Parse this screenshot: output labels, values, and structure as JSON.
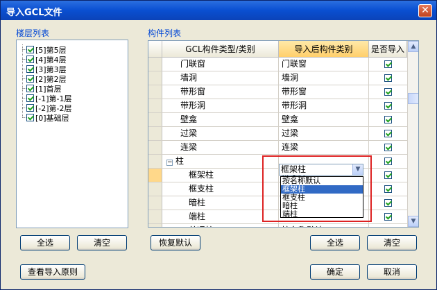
{
  "window": {
    "title": "导入GCL文件",
    "close": "✕"
  },
  "floors": {
    "title": "楼层列表",
    "items": [
      "[5]第5层",
      "[4]第4层",
      "[3]第3层",
      "[2]第2层",
      "[1]首层",
      "[-1]第-1层",
      "[-2]第-2层",
      "[0]基础层"
    ],
    "select_all": "全选",
    "clear": "清空"
  },
  "components": {
    "title": "构件列表",
    "headers": [
      "GCL构件类型/类别",
      "导入后构件类别",
      "是否导入"
    ],
    "rows": [
      {
        "type": "门联窗",
        "target": "门联窗"
      },
      {
        "type": "墙洞",
        "target": "墙洞"
      },
      {
        "type": "带形窗",
        "target": "带形窗"
      },
      {
        "type": "带形洞",
        "target": "带形洞"
      },
      {
        "type": "壁龛",
        "target": "壁龛"
      },
      {
        "type": "过梁",
        "target": "过梁"
      },
      {
        "type": "连梁",
        "target": "连梁"
      },
      {
        "type": "柱",
        "target": "",
        "group": true,
        "toggle": "−"
      },
      {
        "type": "框架柱",
        "target": "框架柱"
      },
      {
        "type": "框支柱",
        "target": ""
      },
      {
        "type": "暗柱",
        "target": ""
      },
      {
        "type": "端柱",
        "target": ""
      },
      {
        "type": "普通柱",
        "target": "按名称默认"
      }
    ],
    "combo_value": "框架柱",
    "dropdown_options": [
      "按名称默认",
      "框架柱",
      "框支柱",
      "暗柱",
      "端柱"
    ],
    "restore_default": "恢复默认",
    "select_all": "全选",
    "clear": "清空"
  },
  "footer": {
    "view_rules": "查看导入原则",
    "ok": "确定",
    "cancel": "取消"
  },
  "colors": {
    "accent": "#0046d5",
    "highlight": "#316ac5",
    "annotation": "#dd2222"
  }
}
